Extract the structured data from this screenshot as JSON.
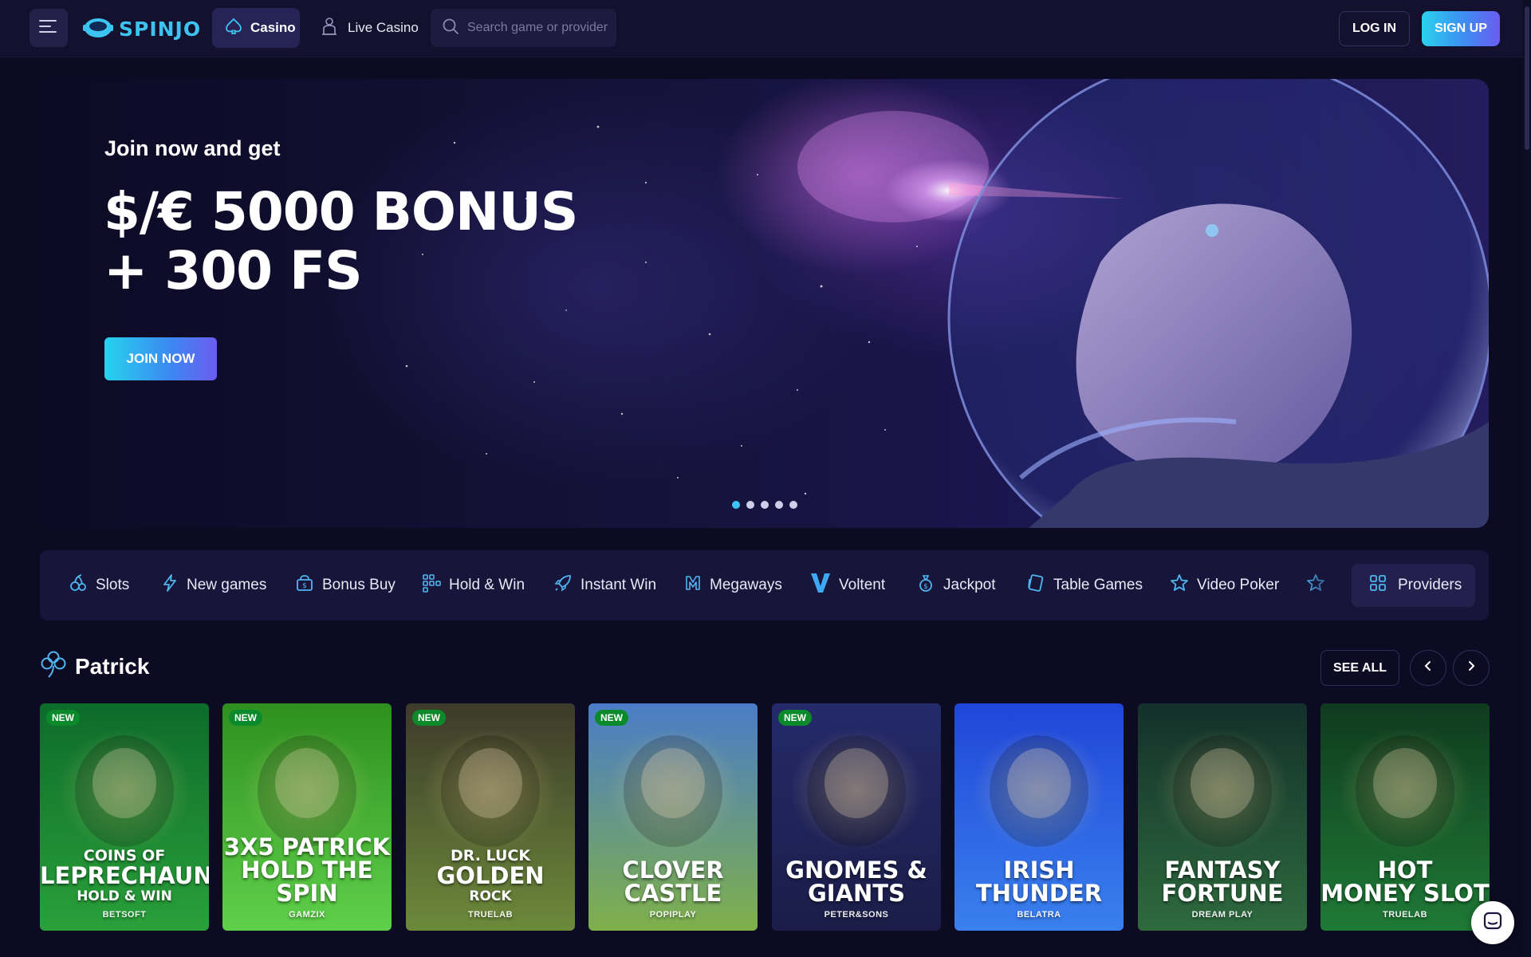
{
  "header": {
    "brand": "SPINJO",
    "nav": {
      "casino": "Casino",
      "live_casino": "Live Casino"
    },
    "search_placeholder": "Search game or provider",
    "login": "LOG IN",
    "signup": "SIGN UP"
  },
  "hero": {
    "intro": "Join now and get",
    "headline_line1": "$/€ 5000 BONUS",
    "headline_line2": "+ 300 FS",
    "cta": "JOIN NOW",
    "slides": 5,
    "active_slide": 1
  },
  "categories": [
    {
      "label": "Slots",
      "icon": "slot-icon"
    },
    {
      "label": "New games",
      "icon": "lightning-icon"
    },
    {
      "label": "Bonus Buy",
      "icon": "bonus-bag-icon"
    },
    {
      "label": "Hold & Win",
      "icon": "grid-dots-icon"
    },
    {
      "label": "Instant Win",
      "icon": "rocket-icon"
    },
    {
      "label": "Megaways",
      "icon": "megaways-icon"
    },
    {
      "label": "Voltent",
      "icon": "voltent-v-icon"
    },
    {
      "label": "Jackpot",
      "icon": "money-bag-icon"
    },
    {
      "label": "Table Games",
      "icon": "cards-icon"
    },
    {
      "label": "Video Poker",
      "icon": "star-icon"
    }
  ],
  "providers_label": "Providers",
  "section": {
    "title": "Patrick",
    "icon": "clover-icon",
    "see_all": "SEE ALL"
  },
  "badge_new": "NEW",
  "games": [
    {
      "top": "COINS OF",
      "main": "LEPRECHAUN",
      "sub": "HOLD & WIN",
      "provider": "BETSOFT",
      "is_new": true,
      "bg": [
        "#0d6b2a",
        "#2aa03a"
      ]
    },
    {
      "top": "",
      "main": "3X5 PATRICK",
      "sub": "HOLD THE SPIN",
      "provider": "GAMZIX",
      "is_new": true,
      "bg": [
        "#2e8f1f",
        "#5fd04a"
      ]
    },
    {
      "top": "DR. LUCK",
      "main": "GOLDEN",
      "sub": "ROCK",
      "provider": "TRUELAB",
      "is_new": true,
      "bg": [
        "#3d3a2a",
        "#6c8a3a"
      ]
    },
    {
      "top": "",
      "main": "CLOVER",
      "sub": "CASTLE",
      "provider": "POPIPLAY",
      "is_new": true,
      "bg": [
        "#4a7cc8",
        "#7fb04a"
      ]
    },
    {
      "top": "",
      "main": "GNOMES &",
      "sub": "GIANTS",
      "provider": "PETER&SONS",
      "is_new": true,
      "bg": [
        "#242a6a",
        "#1b1d48"
      ]
    },
    {
      "top": "",
      "main": "IRISH",
      "sub": "THUNDER",
      "provider": "BELATRA",
      "is_new": false,
      "bg": [
        "#1f46d8",
        "#3a80ee"
      ]
    },
    {
      "top": "",
      "main": "FANTASY",
      "sub": "FORTUNE",
      "provider": "DREAM PLAY",
      "is_new": false,
      "bg": [
        "#13302a",
        "#2e6a3e"
      ]
    },
    {
      "top": "",
      "main": "HOT",
      "sub": "MONEY SLOT",
      "provider": "TRUELAB",
      "is_new": false,
      "bg": [
        "#0f3a1e",
        "#1f7a36"
      ]
    }
  ],
  "colors": {
    "accent": "#39c6f2",
    "page_bg": "#0d0b24",
    "header_bg": "#13112e",
    "badge_new": "#0c8a2b"
  }
}
